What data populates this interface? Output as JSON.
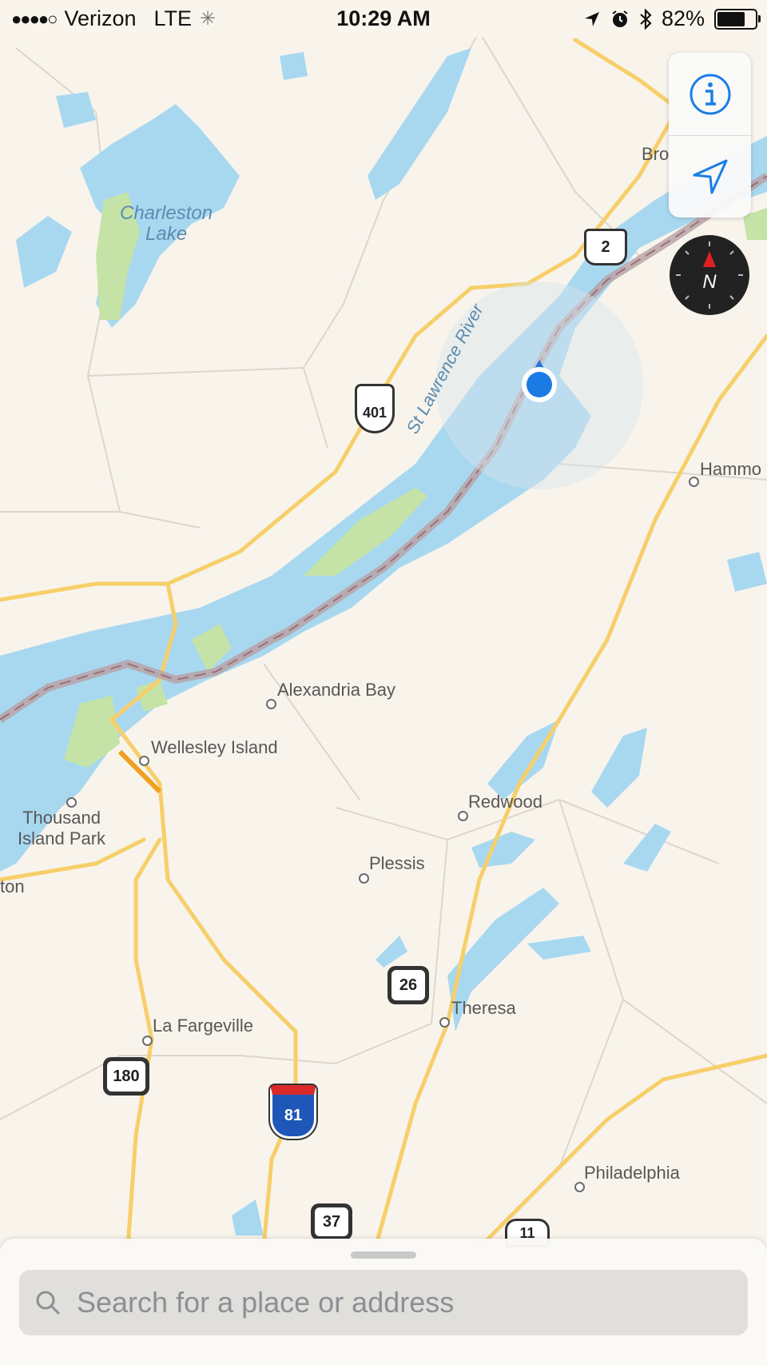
{
  "status_bar": {
    "signal": "●●●●○",
    "carrier": "Verizon",
    "network": "LTE",
    "time": "10:29 AM",
    "battery_percent": "82%",
    "battery_level": 0.82,
    "icons": [
      "location-arrow-icon",
      "alarm-icon",
      "bluetooth-icon",
      "battery-icon"
    ]
  },
  "map": {
    "colors": {
      "land": "#f8f4ec",
      "water": "#a8d8f0",
      "park": "#c5e3a6",
      "highway": "#f7cf6a",
      "border": "#b9a3a8"
    },
    "river_label": "St Lawrence River",
    "lake_labels": [
      "Charleston",
      "Lake"
    ],
    "places": [
      "Bro",
      "Hammo",
      "Alexandria Bay",
      "Wellesley Island",
      "Thousand",
      "Island Park",
      "ton",
      "Redwood",
      "Plessis",
      "Theresa",
      "La Fargeville",
      "Philadelphia"
    ],
    "shields": [
      "2",
      "401",
      "180",
      "81",
      "26",
      "37",
      "11"
    ]
  },
  "controls": {
    "info_icon": "info-icon",
    "locate_icon": "location-arrow-icon",
    "compass_letter": "N"
  },
  "search": {
    "placeholder": "Search for a place or address"
  }
}
